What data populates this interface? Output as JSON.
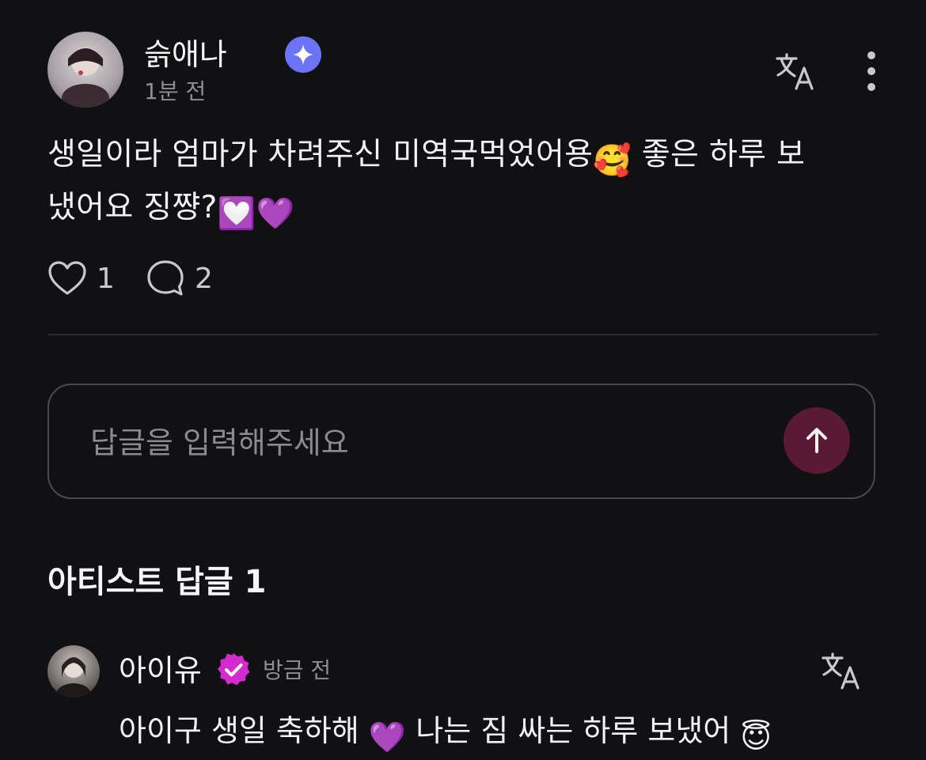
{
  "post": {
    "author": "슭애나",
    "time": "1분 전",
    "body_line1": "생일이라 엄마가 차려주신 미역국먹었어용",
    "body_line1_emoji": "🥰",
    "body_line1_cont": " 좋은 하루 보",
    "body_line2": "냈어요 징쨩?",
    "body_line2_emoji1": "💟",
    "body_line2_emoji2": "💜",
    "likes": "1",
    "comments": "2"
  },
  "reply_input": {
    "placeholder": "답글을 입력해주세요"
  },
  "artist_replies": {
    "title": "아티스트 답글 1",
    "items": [
      {
        "author": "아이유",
        "time": "방금 전",
        "text_part1": "아이구 생일 축하해 ",
        "emoji1": "💜",
        "text_part2": " 나는 짐 싸는 하루 보냈어 ",
        "emoji2": "😇"
      }
    ]
  },
  "colors": {
    "background": "#111113",
    "verified_blue": "#6b74f5",
    "artist_badge": "#d42bd0",
    "send_button": "#5a1a35"
  }
}
